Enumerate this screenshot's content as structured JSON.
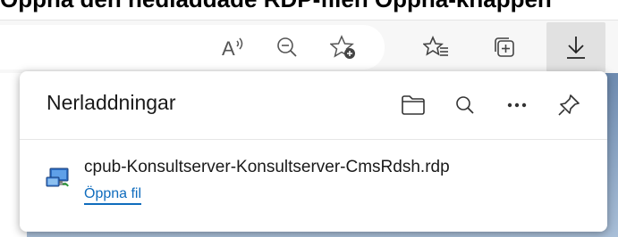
{
  "background_text": "Öppna den nedladdade RDP-filen Öppna-knappen",
  "toolbar": {
    "read_aloud_icon": "read-aloud-icon",
    "zoom_icon": "zoom-out-icon",
    "add_favorite_icon": "add-favorite-icon",
    "favorites_icon": "favorites-icon",
    "collections_icon": "collections-icon",
    "downloads_icon": "download-arrow-icon"
  },
  "downloads": {
    "title": "Nerladdningar",
    "items": [
      {
        "file_name": "cpub-Konsultserver-Konsultserver-CmsRdsh.rdp",
        "action": "Öppna fil"
      }
    ]
  },
  "colors": {
    "link": "#0f6cbd",
    "toolbar_active": "#e1e1e1"
  }
}
